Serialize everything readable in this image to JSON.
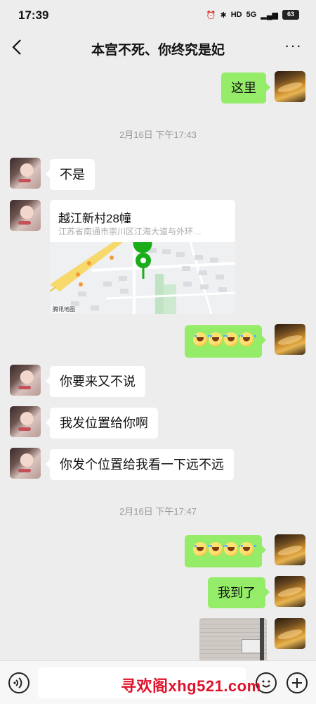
{
  "status_bar": {
    "time": "17:39",
    "network": "5G",
    "battery": "63"
  },
  "header": {
    "title": "本宫不死、你终究是妃"
  },
  "messages": [
    {
      "text": "这里"
    },
    {
      "text": "不是"
    },
    {
      "location_name": "越江新村28幢",
      "location_address": "江苏省南通市崇川区江海大道与外环…",
      "map_label": "腾讯地图"
    },
    {
      "text": "你要来又不说"
    },
    {
      "text": "我发位置给你啊"
    },
    {
      "text": "你发个位置给我看一下远不远"
    },
    {
      "text": "我到了"
    }
  ],
  "timestamps": [
    "2月16日 下午17:43",
    "2月16日 下午17:47"
  ],
  "watermark": "寻欢阁xhg521.com",
  "colors": {
    "bubble_self": "#95ec69",
    "bubble_other": "#ffffff",
    "background": "#ededed",
    "watermark": "#e0112b",
    "map_pin": "#1aad19"
  }
}
